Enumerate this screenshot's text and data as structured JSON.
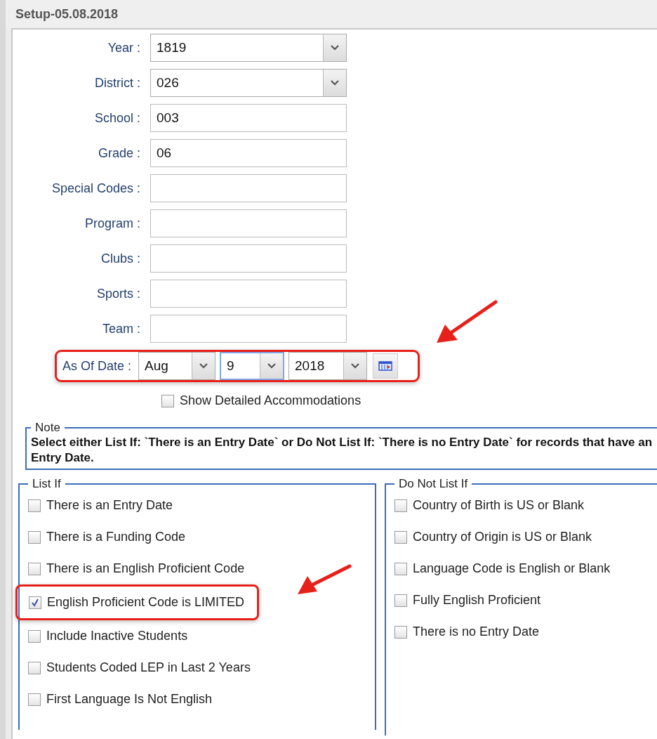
{
  "window": {
    "title": "Setup-05.08.2018"
  },
  "fields": [
    {
      "label": "Year :",
      "kind": "select",
      "value": "1819"
    },
    {
      "label": "District :",
      "kind": "select",
      "value": "026"
    },
    {
      "label": "School :",
      "kind": "text",
      "value": "003"
    },
    {
      "label": "Grade :",
      "kind": "text",
      "value": "06"
    },
    {
      "label": "Special Codes :",
      "kind": "text"
    },
    {
      "label": "Program :",
      "kind": "text"
    },
    {
      "label": "Clubs :",
      "kind": "text"
    },
    {
      "label": "Sports :",
      "kind": "text"
    },
    {
      "label": "Team :",
      "kind": "text"
    }
  ],
  "as_of_date": {
    "label": "As Of Date :",
    "highlighted": true,
    "month": "Aug",
    "day": "9",
    "year": "2018"
  },
  "show_detailed_accommodations": {
    "label": "Show Detailed Accommodations",
    "checked": false
  },
  "note": {
    "title": "Note",
    "text": "Select either List If: `There is an Entry Date` or Do Not List If: `There is no Entry Date` for records that have an Entry Date."
  },
  "list_if": {
    "title": "List If",
    "items": [
      {
        "label": "There is an Entry Date",
        "checked": false,
        "highlighted": false
      },
      {
        "label": "There is a Funding Code",
        "checked": false,
        "highlighted": false
      },
      {
        "label": "There is an English Proficient Code",
        "checked": false,
        "highlighted": false
      },
      {
        "label": "English Proficient Code is LIMITED",
        "checked": true,
        "highlighted": true
      },
      {
        "label": "Include Inactive Students",
        "checked": false,
        "highlighted": false
      },
      {
        "label": "Students Coded LEP in Last 2 Years",
        "checked": false,
        "highlighted": false
      },
      {
        "label": "First Language Is Not English",
        "checked": false,
        "highlighted": false
      }
    ]
  },
  "do_not_list_if": {
    "title": "Do Not List If",
    "items": [
      {
        "label": "Country of Birth is US or Blank",
        "checked": false
      },
      {
        "label": "Country of Origin is US or Blank",
        "checked": false
      },
      {
        "label": "Language Code is English or Blank",
        "checked": false
      },
      {
        "label": "Fully English Proficient",
        "checked": false
      },
      {
        "label": "There is no Entry Date",
        "checked": false
      }
    ]
  }
}
